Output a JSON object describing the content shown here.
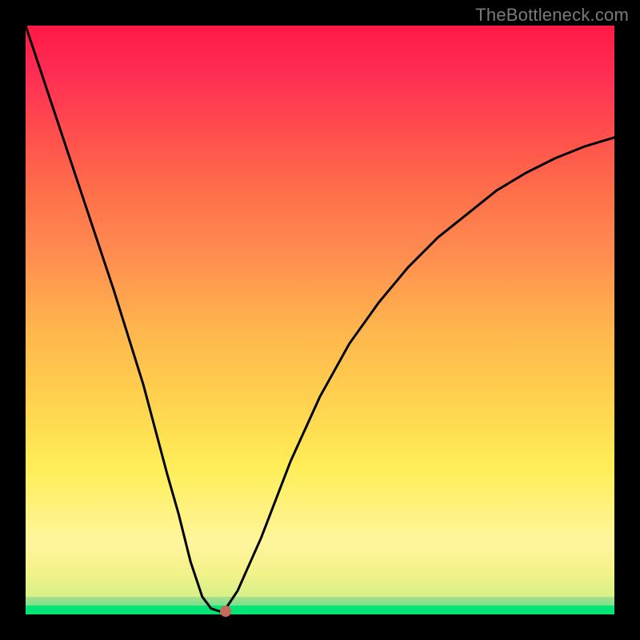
{
  "watermark": "TheBottleneck.com",
  "chart_data": {
    "type": "line",
    "title": "",
    "xlabel": "",
    "ylabel": "",
    "xlim": [
      0,
      100
    ],
    "ylim": [
      0,
      100
    ],
    "grid": false,
    "series": [
      {
        "name": "bottleneck-curve",
        "x": [
          0,
          5,
          10,
          15,
          20,
          24,
          26,
          28,
          30,
          31.5,
          33,
          34,
          36,
          40,
          45,
          50,
          55,
          60,
          65,
          70,
          75,
          80,
          85,
          90,
          95,
          100
        ],
        "y": [
          100,
          85,
          70,
          55,
          39,
          24,
          17,
          9,
          3,
          1,
          0.5,
          1,
          4,
          13,
          26,
          37,
          46,
          53,
          59,
          64,
          68,
          72,
          75,
          77.5,
          79.5,
          81
        ]
      }
    ],
    "marker": {
      "x": 34,
      "y": 0.6,
      "name": "min-point"
    },
    "background_gradient": {
      "bottom": "#00e676",
      "mid": "#ffee58",
      "top": "#ff1846"
    }
  }
}
